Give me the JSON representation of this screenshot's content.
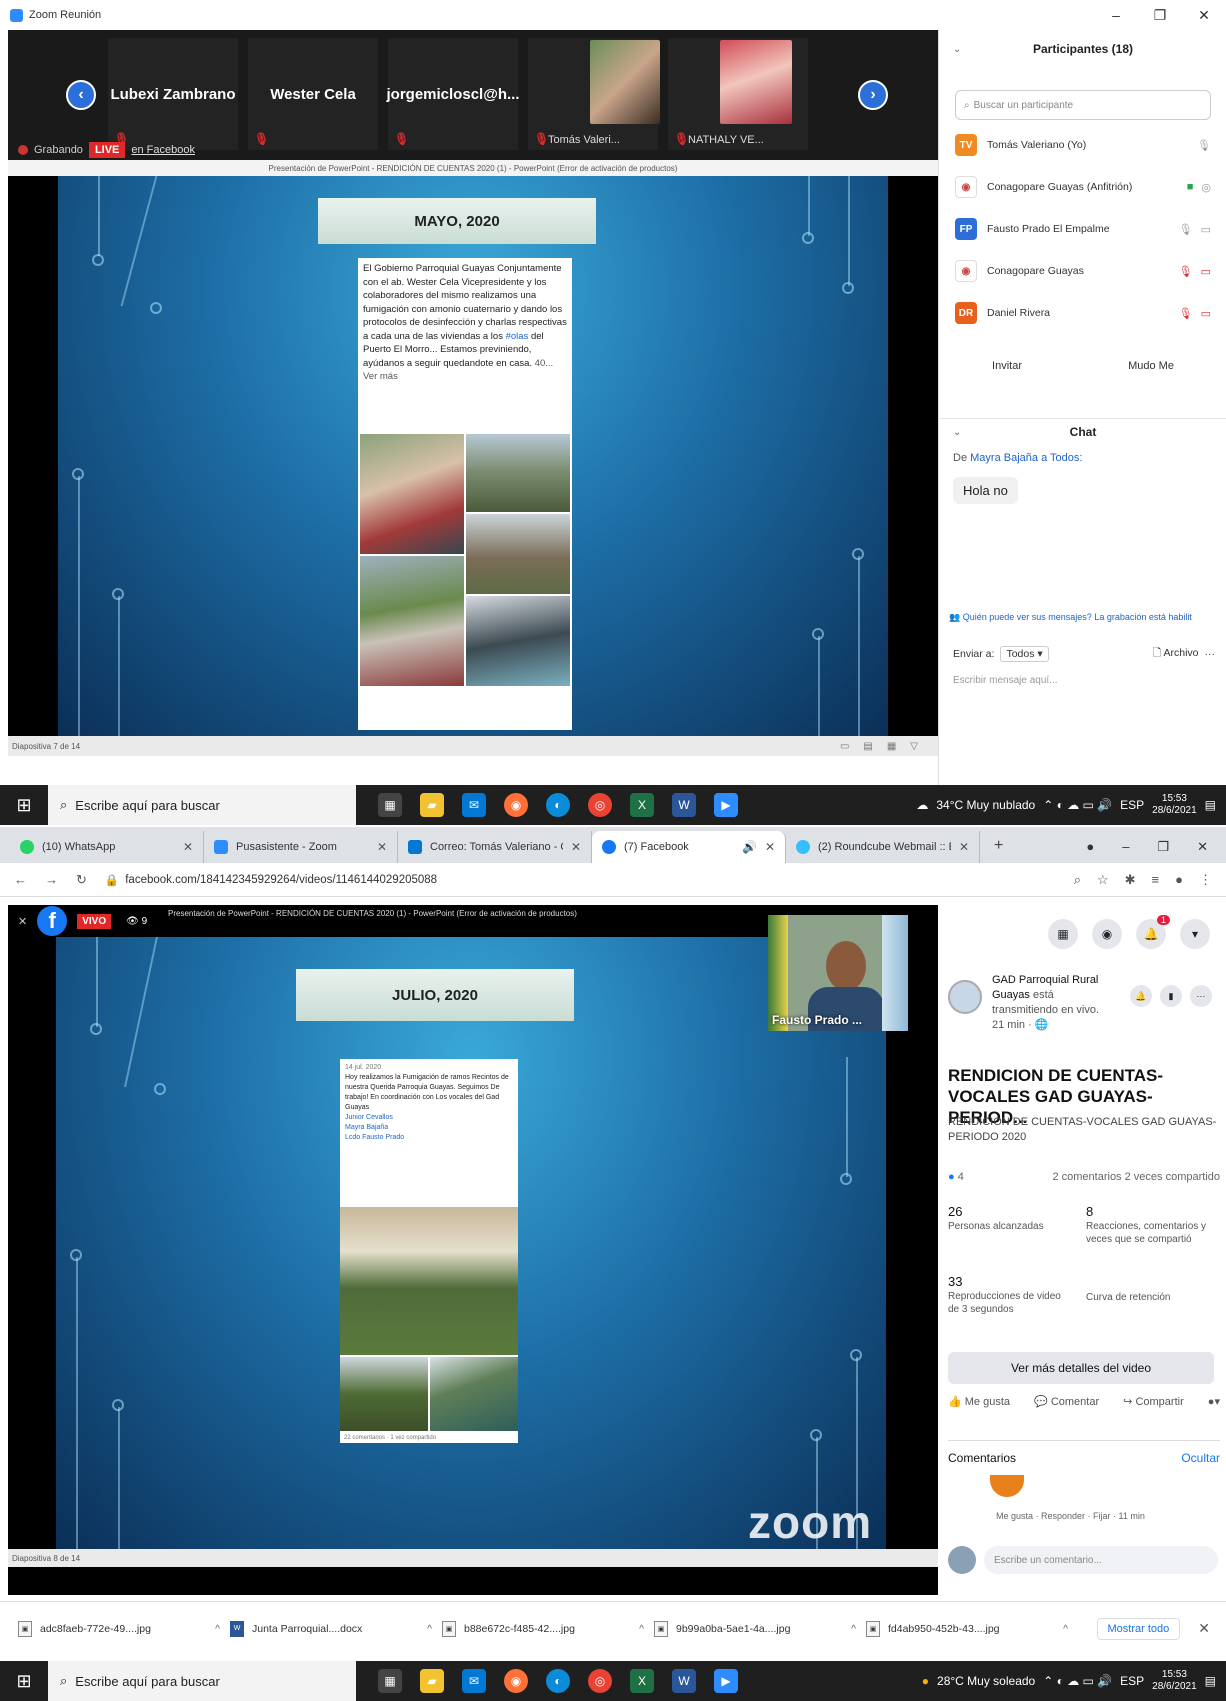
{
  "zoom": {
    "window_title": "Zoom Reunión",
    "gallery": [
      {
        "name": "Lubexi Zambrano"
      },
      {
        "name": "Wester Cela"
      },
      {
        "name": "jorgemicloscl@h..."
      },
      {
        "name": "Tomás Valeri..."
      },
      {
        "name": "NATHALY VE..."
      }
    ],
    "recording_label": "Grabando",
    "live_badge": "LIVE",
    "live_platform": "en Facebook",
    "ppt_title": "Presentación de PowerPoint - RENDICIÓN DE CUENTAS 2020 (1) - PowerPoint (Error de activación de productos)",
    "slide": {
      "title": "MAYO, 2020",
      "post_text": "El Gobierno Parroquial Guayas Conjuntamente con el ab. Wester Cela Vicepresidente y los colaboradores del mismo realizamos una fumigación con amonio cuaternario y dando los protocolos de desinfección y charlas respectivas a cada una de las viviendas a los",
      "post_tag": "#olas",
      "post_text2": "del Puerto El Morro...",
      "post_text3": "Estamos previniendo, ayúdanos a seguir quedandote en casa.",
      "post_more": "40... Ver más"
    },
    "slide_footer": "Diapositiva 7 de 14",
    "participants": {
      "header": "Participantes (18)",
      "search_placeholder": "Buscar un participante",
      "list": [
        {
          "initials": "TV",
          "name": "Tomás Valeriano (Yo)",
          "color": "#f08a24"
        },
        {
          "initials": "",
          "name": "Conagopare Guayas (Anfitrión)",
          "color": "#ffffff"
        },
        {
          "initials": "FP",
          "name": "Fausto Prado El Empalme",
          "color": "#2d6fd8"
        },
        {
          "initials": "",
          "name": "Conagopare Guayas",
          "color": "#ffffff"
        },
        {
          "initials": "DR",
          "name": "Daniel Rivera",
          "color": "#e8601c"
        }
      ],
      "invite": "Invitar",
      "mute_me": "Mudo Me"
    },
    "chat": {
      "header": "Chat",
      "from_prefix": "De",
      "from_name": "Mayra Bajaña",
      "to": "a Todos:",
      "message": "Hola no",
      "warning": "Quién puede ver sus mensajes? La grabación está habilit",
      "send_to_label": "Enviar a:",
      "send_to_value": "Todos",
      "file_label": "Archivo",
      "input_placeholder": "Escribir mensaje aquí..."
    }
  },
  "taskbar": {
    "search_placeholder": "Escribe aquí para buscar",
    "weather1": "34°C  Muy nublado",
    "weather2": "28°C  Muy soleado",
    "lang": "ESP",
    "time": "15:53",
    "date": "28/6/2021"
  },
  "browser": {
    "tabs": [
      {
        "label": "(10) WhatsApp",
        "color": "#25d366"
      },
      {
        "label": "Pusasistente - Zoom",
        "color": "#2d8cff"
      },
      {
        "label": "Correo: Tomás Valeriano - O...",
        "color": "#0078d4"
      },
      {
        "label": "(7) Facebook",
        "color": "#1877f2"
      },
      {
        "label": "(2) Roundcube Webmail :: En...",
        "color": "#37beff"
      }
    ],
    "url": "facebook.com/184142345929264/videos/1146144029205088"
  },
  "fb": {
    "vivo": "VIVO",
    "viewers": "9",
    "camera_name": "Fausto Prado ...",
    "slide": {
      "title": "JULIO, 2020",
      "date": "14 jul. 2020",
      "text": "Hoy realizamos la Fumigación de ramos Recintos de nuestra Querida Parroquia Guayas. Seguimos De trabajo! En coordinación con Los vocales del Gad Guayas",
      "tags": "Junior Cevallos\nMayra Bajaña\nLcdo Fausto Prado",
      "footer": "22 comentarios · 1 vez compartido"
    },
    "zoom_mark": "zoom",
    "slide_footer": "Diapositiva 8 de 14",
    "page_name": "GAD Parroquial Rural Guayas",
    "page_status": "está transmitiendo en vivo.",
    "page_time": "21 min · ",
    "video_title": "RENDICION DE CUENTAS-VOCALES GAD GUAYAS-PERIOD...",
    "video_desc": "RENDICION DE CUENTAS-VOCALES GAD GUAYAS-PERIODO 2020",
    "reactions": "4",
    "comments_shares": "2 comentarios  2 veces compartido",
    "metrics": [
      {
        "value": "26",
        "label": "Personas alcanzadas"
      },
      {
        "value": "8",
        "label": "Reacciones, comentarios y veces que se compartió"
      },
      {
        "value": "33",
        "label": "Reproducciones de video de 3 segundos"
      },
      {
        "value": "",
        "label": "Curva de retención"
      }
    ],
    "more_details": "Ver más detalles del video",
    "like": "Me gusta",
    "comment": "Comentar",
    "share": "Compartir",
    "comments_label": "Comentarios",
    "hide_label": "Ocultar",
    "comment_meta": "Me gusta · Responder · Fijar · 11 min",
    "comment_placeholder": "Escribe un comentario..."
  },
  "downloads": {
    "items": [
      {
        "name": "adc8faeb-772e-49....jpg",
        "type": "img"
      },
      {
        "name": "Junta Parroquial....docx",
        "type": "doc"
      },
      {
        "name": "b88e672c-f485-42....jpg",
        "type": "img"
      },
      {
        "name": "9b99a0ba-5ae1-4a....jpg",
        "type": "img"
      },
      {
        "name": "fd4ab950-452b-43....jpg",
        "type": "img"
      }
    ],
    "show_all": "Mostrar todo"
  }
}
